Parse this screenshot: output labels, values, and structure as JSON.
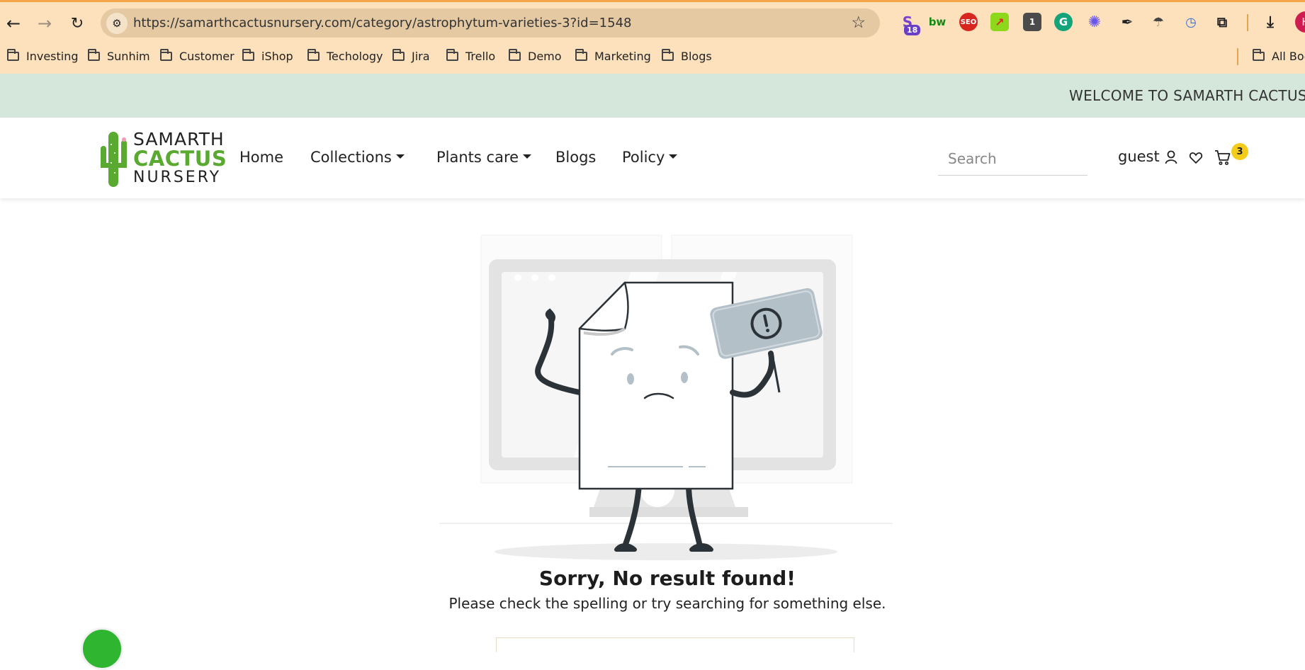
{
  "browser": {
    "url": "https://samarthcactusnursery.com/category/astrophytum-varieties-3?id=1548",
    "extension_badge": "18",
    "bookmarks": [
      "Investing",
      "Sunhim",
      "Customer",
      "iShop",
      "Techology",
      "Jira",
      "Trello",
      "Demo",
      "Marketing",
      "Blogs"
    ],
    "all_bookmarks_label": "All Boo",
    "profile_initial": "H"
  },
  "site": {
    "welcome": "WELCOME TO SAMARTH CACTUS N",
    "logo": {
      "line1": "SAMARTH",
      "line2": "CACTUS",
      "line3": "NURSERY"
    },
    "nav": {
      "home": "Home",
      "collections": "Collections",
      "plants_care": "Plants care",
      "blogs": "Blogs",
      "policy": "Policy"
    },
    "search_placeholder": "Search",
    "user_label": "guest",
    "cart_count": "3"
  },
  "content": {
    "title": "Sorry, No result found!",
    "subtitle": "Please check the spelling or try searching for something else."
  },
  "colors": {
    "browser_bg": "#fde1bd",
    "welcome_bg": "#d5e6db",
    "brand_green": "#5aaa32",
    "cart_badge": "#f4cd1c"
  }
}
